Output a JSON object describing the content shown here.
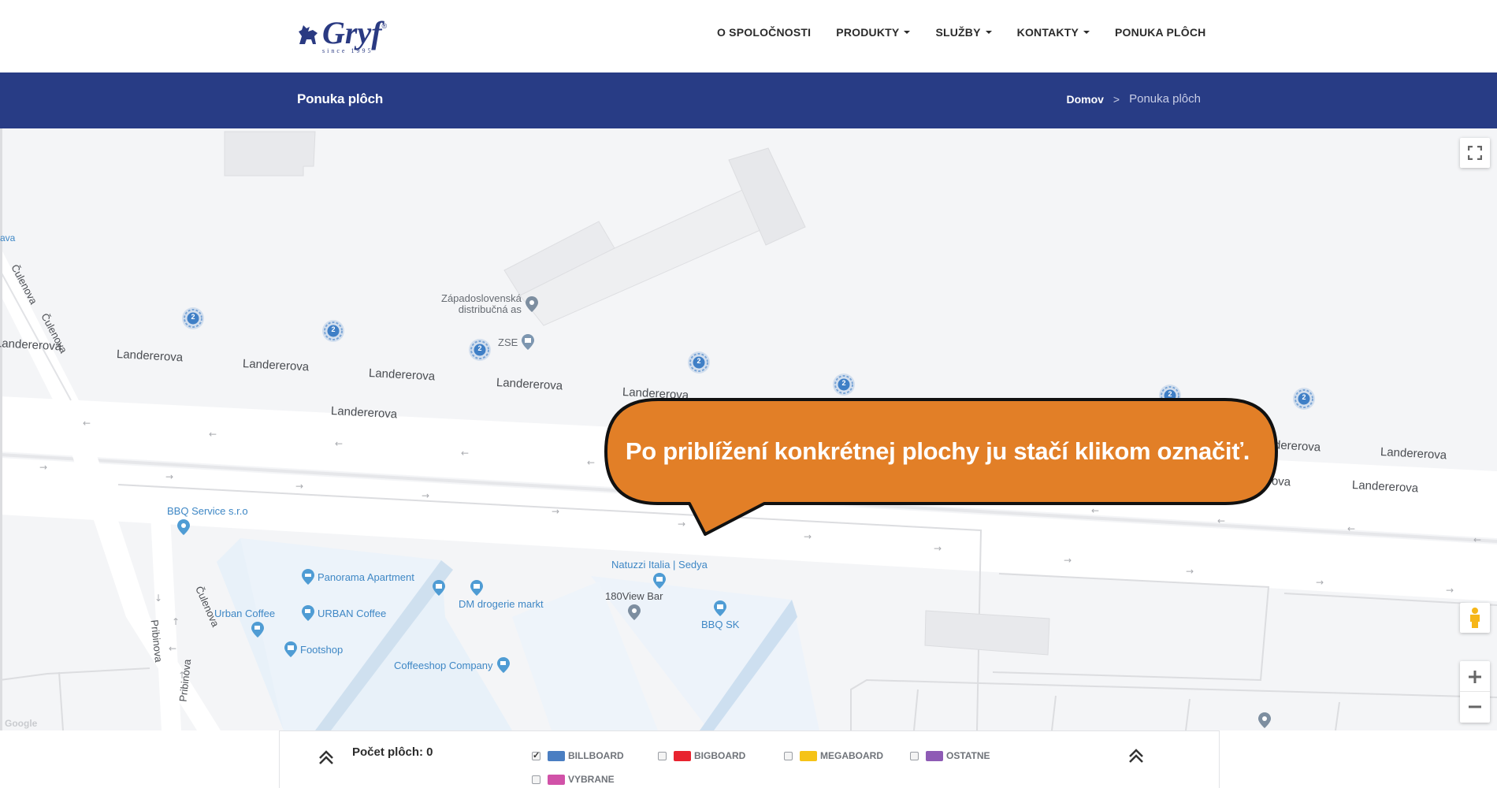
{
  "header": {
    "logo_text": "Gryf",
    "logo_reg": "®",
    "logo_since": "since 1995",
    "nav": [
      {
        "label": "O SPOLOČNOSTI",
        "dropdown": false
      },
      {
        "label": "PRODUKTY",
        "dropdown": true
      },
      {
        "label": "SLUŽBY",
        "dropdown": true
      },
      {
        "label": "KONTAKTY",
        "dropdown": true
      },
      {
        "label": "PONUKA PLÔCH",
        "dropdown": false
      }
    ]
  },
  "titlebar": {
    "title": "Ponuka plôch",
    "breadcrumb_home": "Domov",
    "breadcrumb_sep": ">",
    "breadcrumb_current": "Ponuka plôch"
  },
  "map": {
    "tooltip": "Po priblížení konkrétnej plochy ju stačí klikom označiť.",
    "pois": [
      {
        "label": "Západoslovenská distribučná as",
        "line1": "Západoslovenská",
        "line2": "distribučná as"
      },
      {
        "label": "ZSE"
      },
      {
        "label": "BBQ Service s.r.o"
      },
      {
        "label": "Panorama Apartment"
      },
      {
        "label": "URBAN Coffee"
      },
      {
        "label": "Urban Coffee"
      },
      {
        "label": "Footshop"
      },
      {
        "label": "DM drogerie markt"
      },
      {
        "label": "Coffeeshop Company"
      },
      {
        "label": "Natuzzi Italia | Sedya"
      },
      {
        "label": "180View Bar"
      },
      {
        "label": "BBQ SK"
      }
    ],
    "streets": {
      "main": "Landererova",
      "culenova": "Čulenova",
      "pribinova": "Pribinova",
      "edge": "ava"
    },
    "cluster_count": "2",
    "cluster_color": "#3f7fc6",
    "google_mark": "Google"
  },
  "legend": {
    "count_label": "Počet plôch: 0",
    "items": [
      {
        "label": "BILLBOARD",
        "color": "#4a7ec2",
        "checked": true
      },
      {
        "label": "BIGBOARD",
        "color": "#e8232f",
        "checked": false
      },
      {
        "label": "MEGABOARD",
        "color": "#f5c317",
        "checked": false
      },
      {
        "label": "OSTATNE",
        "color": "#8e5bb5",
        "checked": false
      },
      {
        "label": "VYBRANE",
        "color": "#d152a8",
        "checked": false
      }
    ]
  }
}
